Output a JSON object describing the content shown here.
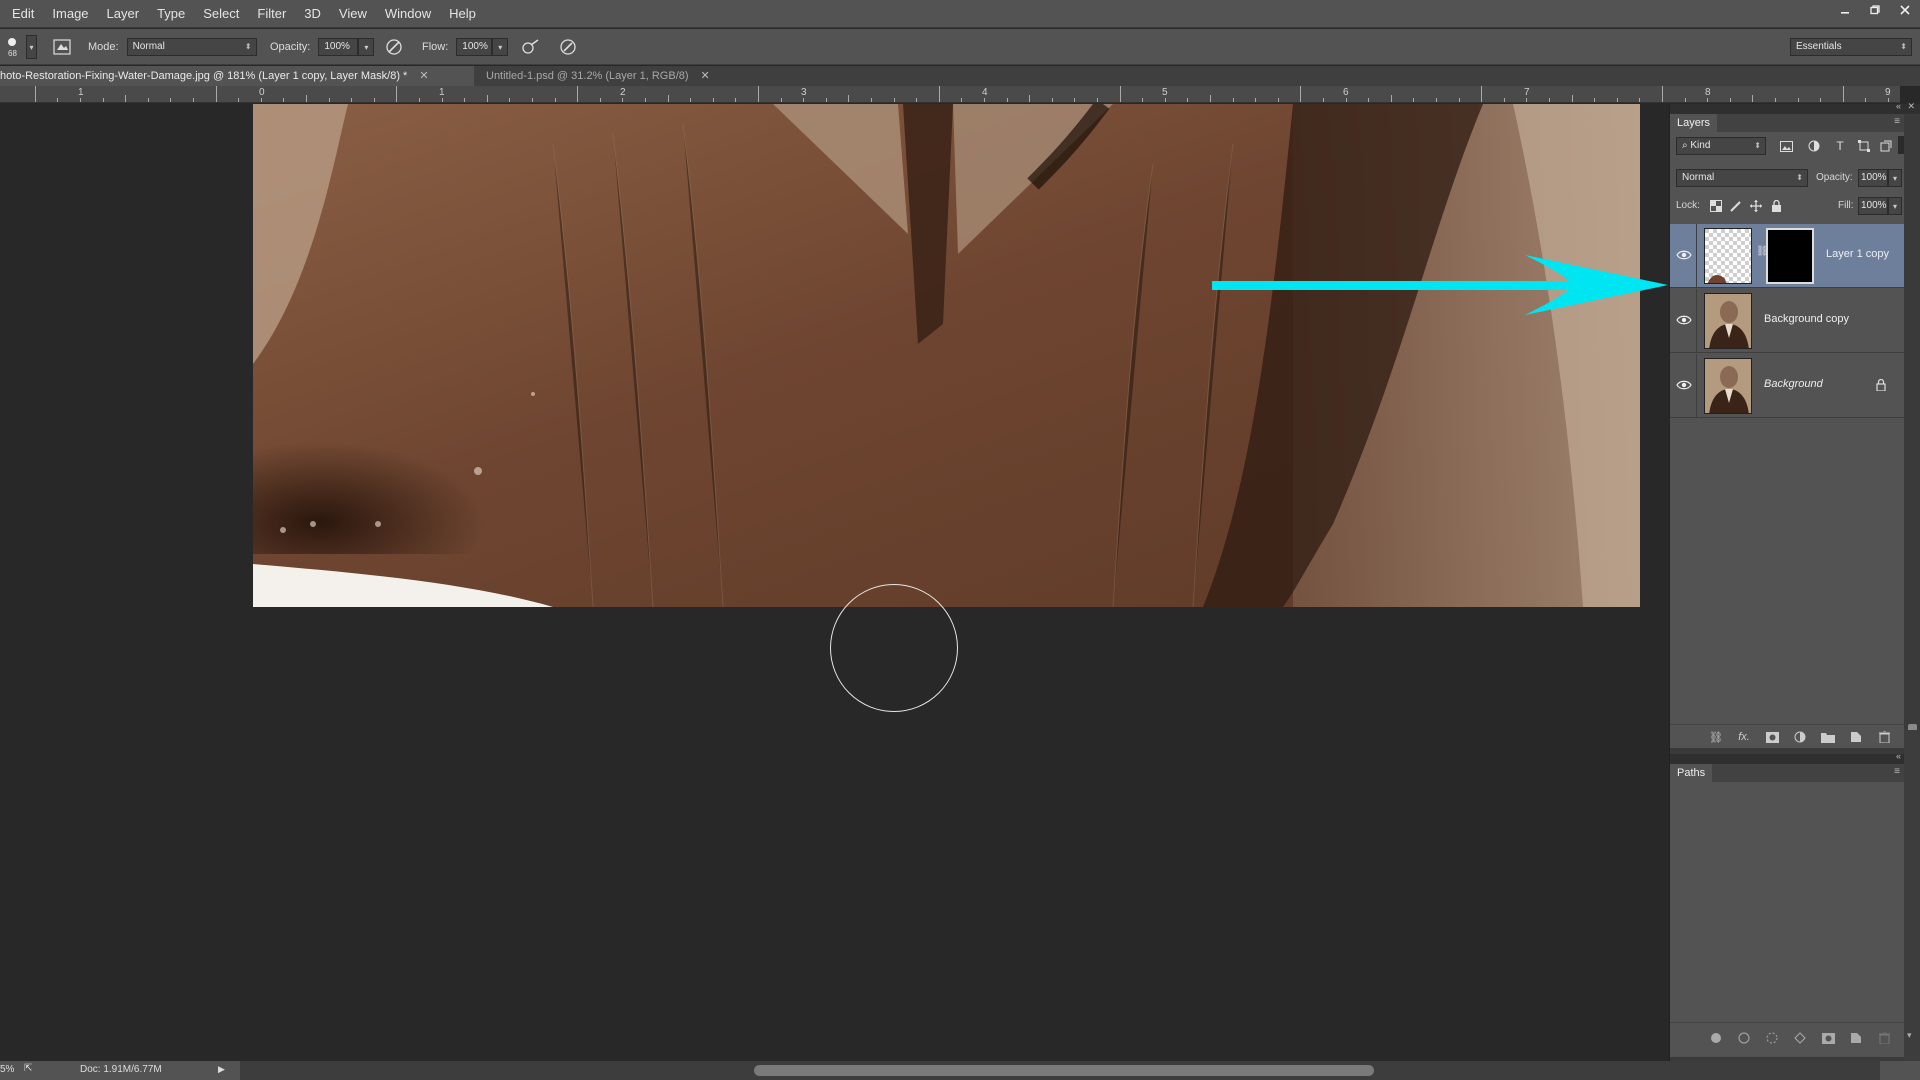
{
  "menu": [
    "Edit",
    "Image",
    "Layer",
    "Type",
    "Select",
    "Filter",
    "3D",
    "View",
    "Window",
    "Help"
  ],
  "options": {
    "brush_size": "68",
    "mode_label": "Mode:",
    "mode_value": "Normal",
    "opacity_label": "Opacity:",
    "opacity_value": "100%",
    "flow_label": "Flow:",
    "flow_value": "100%",
    "workspace": "Essentials"
  },
  "tabs": [
    {
      "label": "hoto-Restoration-Fixing-Water-Damage.jpg @ 181% (Layer 1 copy, Layer Mask/8) *",
      "active": true
    },
    {
      "label": "Untitled-1.psd @ 31.2% (Layer 1, RGB/8)",
      "active": false
    }
  ],
  "ruler_labels": [
    "1",
    "0",
    "1",
    "2",
    "3",
    "4",
    "5",
    "6",
    "7",
    "8",
    "9"
  ],
  "layers_panel": {
    "title": "Layers",
    "kind_filter": "Kind",
    "blend_mode": "Normal",
    "opacity_label": "Opacity:",
    "opacity_value": "100%",
    "lock_label": "Lock:",
    "fill_label": "Fill:",
    "fill_value": "100%",
    "layers": [
      {
        "name": "Layer 1 copy",
        "selected": true
      },
      {
        "name": "Background copy",
        "selected": false
      },
      {
        "name": "Background",
        "selected": false,
        "locked": true
      }
    ]
  },
  "paths_panel": {
    "title": "Paths"
  },
  "status": {
    "zoom": "5%",
    "doc": "Doc: 1.91M/6.77M"
  },
  "colors": {
    "annotation_arrow": "#00e5f2",
    "selected_layer": "#6e7f9c"
  }
}
